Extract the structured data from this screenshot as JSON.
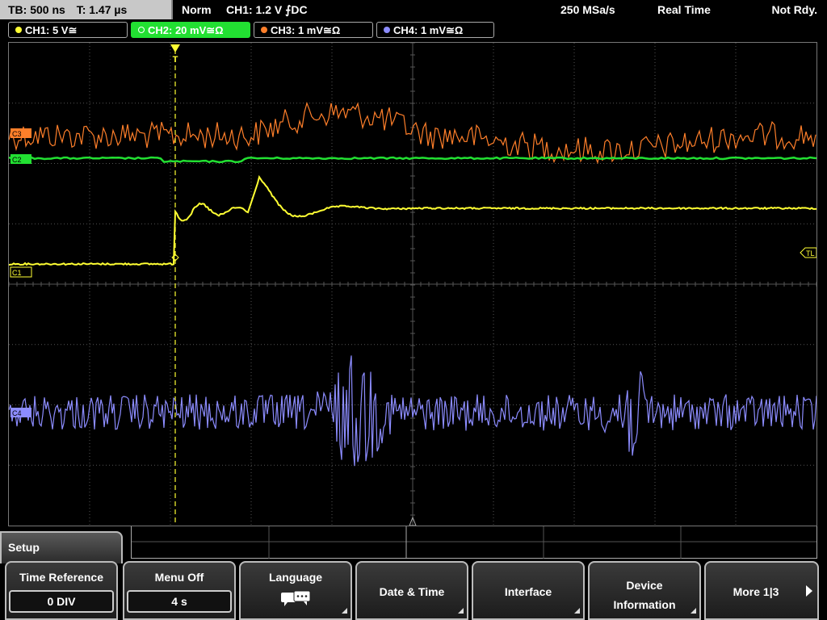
{
  "topbar": {
    "timebase": "TB: 500 ns",
    "trigger_time": "T: 1.47 µs",
    "mode": "Norm",
    "trigger": "CH1: 1.2 V ⨍DC",
    "sample_rate": "250 MSa/s",
    "acquisition": "Real Time",
    "status": "Not Rdy."
  },
  "channels": [
    {
      "label": "CH1: 5 V≅",
      "color": "#ffff33"
    },
    {
      "label": "CH2: 20 mV≅Ω",
      "color": "#22e032"
    },
    {
      "label": "CH3: 1 mV≅Ω",
      "color": "#ff7f2a"
    },
    {
      "label": "CH4: 1 mV≅Ω",
      "color": "#8c8cff"
    }
  ],
  "markers": {
    "ch3": "C3",
    "ch2": "C2",
    "ch1": "C1",
    "ch4": "C4",
    "trigger_level": "TL",
    "trigger_pos": "T"
  },
  "menu": {
    "title": "Setup",
    "softkeys": [
      {
        "label": "Time Reference",
        "value": "0 DIV"
      },
      {
        "label": "Menu Off",
        "value": "4 s"
      },
      {
        "label": "Language",
        "icon": "speech-bubbles-icon"
      },
      {
        "label": "Date & Time"
      },
      {
        "label": "Interface"
      },
      {
        "label": "Device Information"
      },
      {
        "label": "More 1|3"
      }
    ]
  },
  "colors": {
    "ch1": "#ffff33",
    "ch2": "#22e032",
    "ch3": "#ff7f2a",
    "ch4": "#8c8cff",
    "grid": "#5a5a5a"
  }
}
